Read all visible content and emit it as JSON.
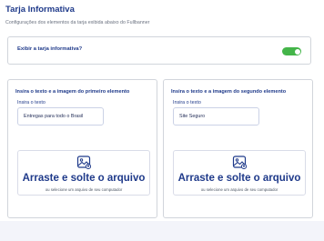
{
  "header": {
    "title": "Tarja Informativa",
    "subtitle": "Configurações dos elementos da tarja exibida abaixo do Fullbanner"
  },
  "toggle": {
    "label": "Exibir a tarja informativa?",
    "enabled": true,
    "color": "#44b549"
  },
  "panels": [
    {
      "title": "Insira o texto e a imagem do primeiro elemento",
      "field_label": "Insira o texto",
      "field_value": "Entregas para todo o Brasil",
      "dropzone": {
        "icon": "image-upload-icon",
        "main_text": "Arraste e solte o arquivo",
        "sub_text": "ou selecione um arquivo de seu computador"
      }
    },
    {
      "title": "Insira o texto e a imagem do segundo elemento",
      "field_label": "Insira o texto",
      "field_value": "Site Seguro",
      "dropzone": {
        "icon": "image-upload-icon",
        "main_text": "Arraste e solte o arquivo",
        "sub_text": "ou selecione um arquivo de seu computador"
      }
    }
  ],
  "colors": {
    "accent": "#1f3a8a",
    "toggle_on": "#44b549",
    "background": "#f3f4fa"
  }
}
